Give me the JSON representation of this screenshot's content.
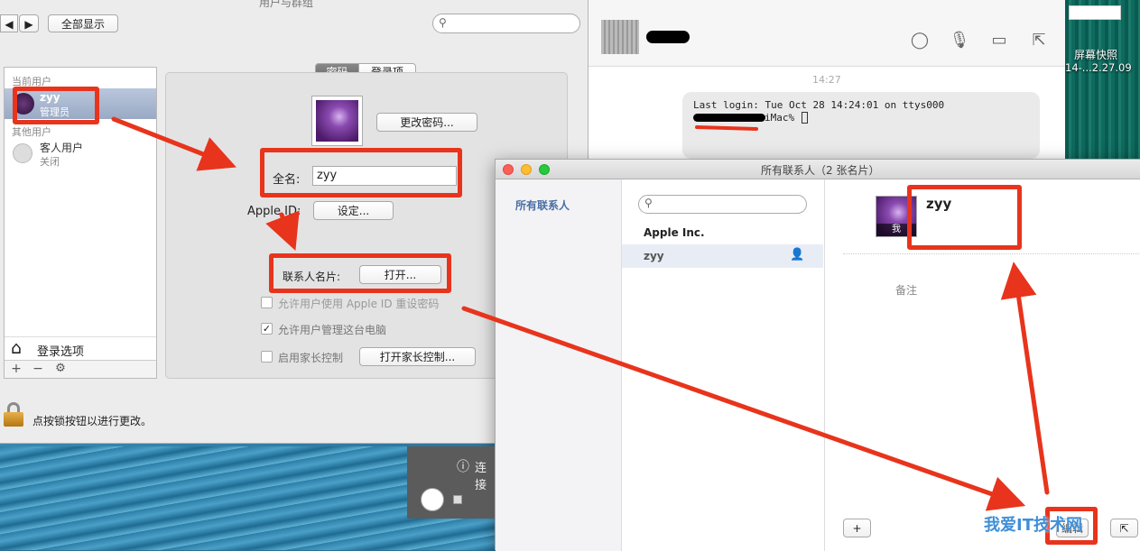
{
  "sysprefs": {
    "title": "用户与群组",
    "show_all": "全部显示",
    "current_users_header": "当前用户",
    "other_users_header": "其他用户",
    "user": {
      "name": "zyy",
      "role": "管理员"
    },
    "guest": {
      "name": "客人用户",
      "status": "关闭"
    },
    "login_options": "登录选项",
    "tabs": [
      "密码",
      "登录项"
    ],
    "change_password": "更改密码...",
    "full_name_label": "全名:",
    "full_name_value": "zyy",
    "apple_id_label": "Apple ID:",
    "set_button": "设定...",
    "contact_card_label": "联系人名片:",
    "open_button": "打开...",
    "checkbox_reset": "允许用户使用 Apple ID 重设密码",
    "checkbox_admin": "允许用户管理这台电脑",
    "checkbox_parental": "启用家长控制",
    "open_parental": "打开家长控制...",
    "lock_text": "点按锁按钮以进行更改。",
    "add": "+",
    "remove": "−"
  },
  "messages": {
    "time": "14:27",
    "terminal_line1": "Last login: Tue Oct 28 14:24:01 on ttys000",
    "terminal_line2": "iMac% "
  },
  "desktop": {
    "screenshot_label1": "屏幕快照",
    "screenshot_label2": "14-...2.27.09"
  },
  "contacts": {
    "title": "所有联系人（2 张名片）",
    "group": "所有联系人",
    "list": [
      "Apple Inc.",
      "zyy"
    ],
    "card_name": "zyy",
    "me_badge": "我",
    "note_label": "备注",
    "add": "+",
    "edit": "编辑"
  },
  "notification": {
    "text": "连接"
  },
  "watermark": {
    "text": "我爱IT技术网"
  },
  "colors": {
    "annotation": "#e8341c",
    "selection": "#a9b7d0"
  }
}
